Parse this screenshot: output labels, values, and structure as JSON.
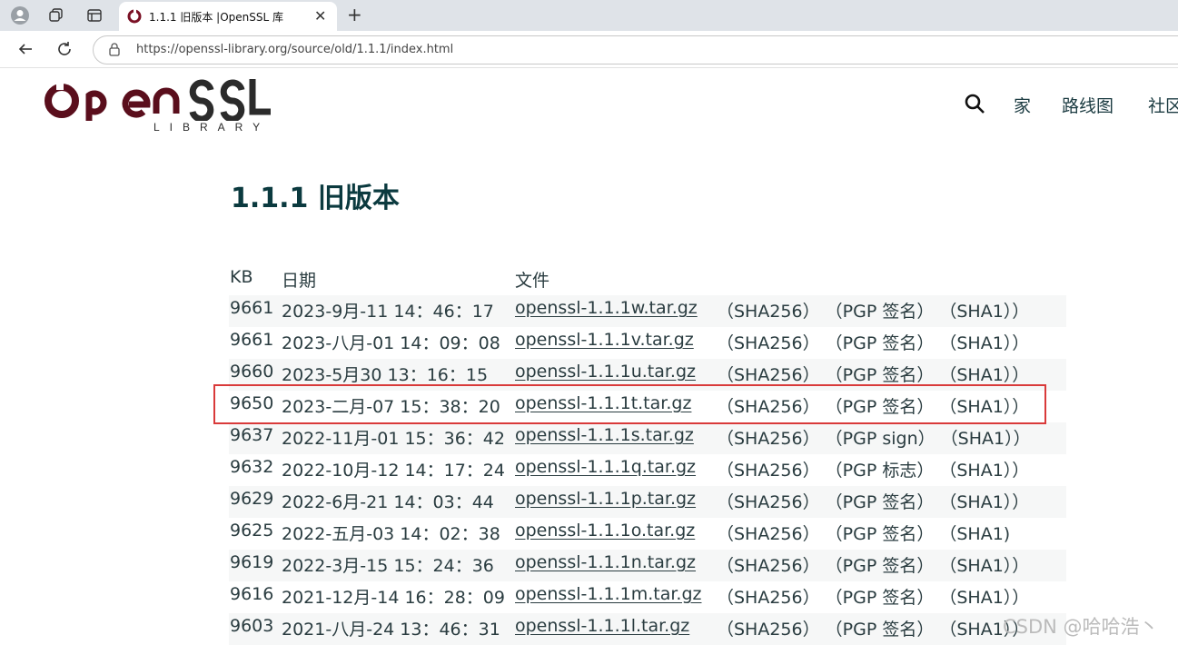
{
  "browser": {
    "tab_title": "1.1.1 旧版本 |OpenSSL 库",
    "tab_close": "✕",
    "new_tab": "+",
    "url": "https://openssl-library.org/source/old/1.1.1/index.html"
  },
  "site": {
    "logo_sub": "LIBRARY",
    "nav": [
      "家",
      "路线图",
      "社区"
    ]
  },
  "page": {
    "title": "1.1.1 旧版本",
    "headers": {
      "kb": "KB",
      "date": "日期",
      "file": "文件"
    },
    "rows": [
      {
        "kb": "9661",
        "date": "2023-9月-11 14：46：17",
        "file": "openssl-1.1.1w.tar.gz",
        "extras": "（SHA256） （PGP 签名） （SHA1））"
      },
      {
        "kb": "9661",
        "date": "2023-八月-01 14：09：08",
        "file": "openssl-1.1.1v.tar.gz",
        "extras": "（SHA256） （PGP 签名） （SHA1））"
      },
      {
        "kb": "9660",
        "date": "2023-5月30 13：16：15",
        "file": "openssl-1.1.1u.tar.gz",
        "extras": "（SHA256） （PGP 签名） （SHA1））"
      },
      {
        "kb": "9650",
        "date": "2023-二月-07 15：38：20",
        "file": "openssl-1.1.1t.tar.gz",
        "extras": "（SHA256） （PGP 签名） （SHA1））"
      },
      {
        "kb": "9637",
        "date": "2022-11月-01 15：36：42",
        "file": "openssl-1.1.1s.tar.gz",
        "extras": "（SHA256） （PGP sign） （SHA1））"
      },
      {
        "kb": "9632",
        "date": "2022-10月-12 14：17：24",
        "file": "openssl-1.1.1q.tar.gz",
        "extras": "（SHA256） （PGP 标志） （SHA1））"
      },
      {
        "kb": "9629",
        "date": "2022-6月-21 14：03：44",
        "file": "openssl-1.1.1p.tar.gz",
        "extras": "（SHA256） （PGP 签名） （SHA1））"
      },
      {
        "kb": "9625",
        "date": "2022-五月-03 14：02：38",
        "file": "openssl-1.1.1o.tar.gz",
        "extras": "（SHA256） （PGP 签名） （SHA1)"
      },
      {
        "kb": "9619",
        "date": "2022-3月-15 15：24：36",
        "file": "openssl-1.1.1n.tar.gz",
        "extras": "（SHA256） （PGP 签名） （SHA1））"
      },
      {
        "kb": "9616",
        "date": "2021-12月-14 16：28：09",
        "file": "openssl-1.1.1m.tar.gz",
        "extras": "（SHA256） （PGP 签名） （SHA1））"
      },
      {
        "kb": "9603",
        "date": "2021-八月-24 13：46：31",
        "file": "openssl-1.1.1l.tar.gz",
        "extras": "（SHA256） （PGP 签名） （SHA1））"
      }
    ]
  },
  "watermark": "CSDN @哈哈浩丶",
  "colors": {
    "brand_dark_red": "#5a0e1c",
    "title_teal": "#0b3a3f",
    "highlight_red": "#d93a3a"
  }
}
